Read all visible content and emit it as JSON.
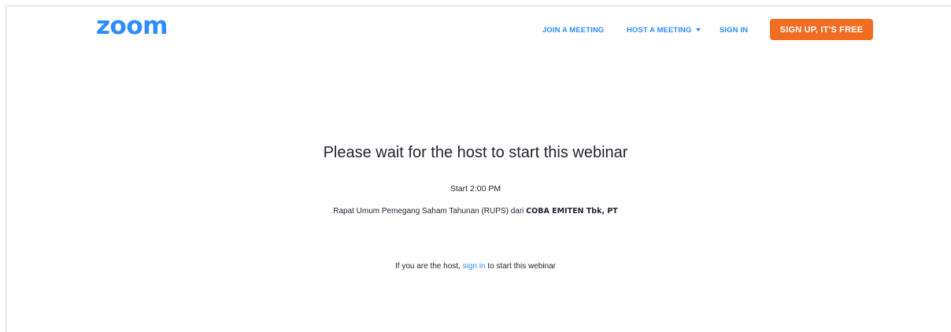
{
  "header": {
    "logo_text": "zoom",
    "nav": {
      "join_label": "JOIN A MEETING",
      "host_label": "HOST A MEETING",
      "signin_label": "SIGN IN",
      "signup_label": "SIGN UP, IT'S FREE"
    }
  },
  "main": {
    "headline": "Please wait for the host to start this webinar",
    "start_time": "Start 2:00 PM",
    "meeting_title_prefix": "Rapat Umum Pemegang Saham Tahunan (RUPS) dari ",
    "meeting_company": "COBA EMITEN Tbk, PT",
    "host_note_before": "If you are the host, ",
    "host_note_link": "sign in",
    "host_note_after": " to start this webinar"
  },
  "colors": {
    "brand_blue": "#2d8cff",
    "signup_orange": "#f26d21"
  },
  "icons": {
    "host_dropdown": "chevron-down-icon"
  }
}
